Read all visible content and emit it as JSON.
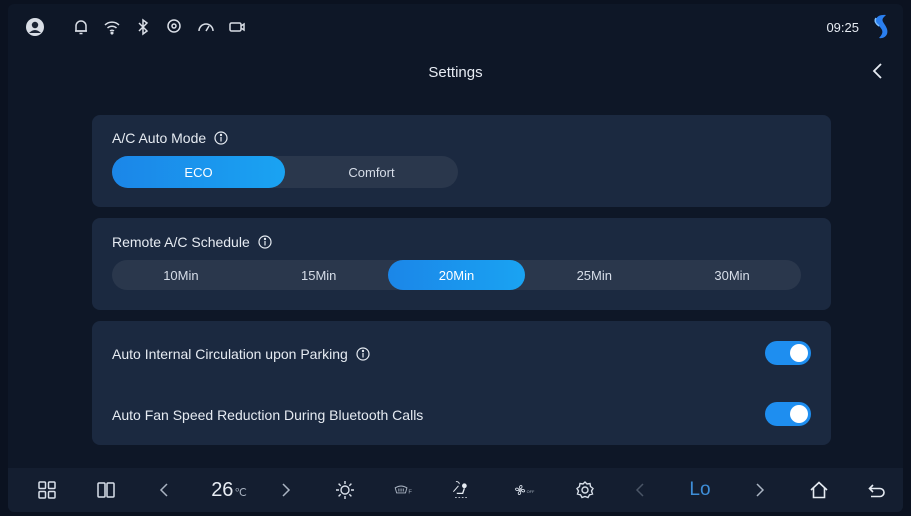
{
  "status_bar": {
    "time": "09:25",
    "icons": [
      "avatar-icon",
      "bell-icon",
      "wifi-icon",
      "bluetooth-icon",
      "location-icon",
      "speedometer-icon",
      "camera-icon"
    ]
  },
  "header": {
    "title": "Settings"
  },
  "ac_auto_mode": {
    "label": "A/C Auto Mode",
    "options": [
      "ECO",
      "Comfort"
    ],
    "selected": "ECO"
  },
  "remote_schedule": {
    "label": "Remote A/C Schedule",
    "options": [
      "10Min",
      "15Min",
      "20Min",
      "25Min",
      "30Min"
    ],
    "selected": "20Min"
  },
  "toggles": [
    {
      "label": "Auto Internal Circulation upon Parking",
      "on": true,
      "info": true
    },
    {
      "label": "Auto Fan Speed Reduction During Bluetooth Calls",
      "on": true,
      "info": false
    }
  ],
  "dock": {
    "temperature": "26",
    "temperature_unit": "℃",
    "fan_level": "Lo",
    "accent": "#1e8ef0"
  }
}
